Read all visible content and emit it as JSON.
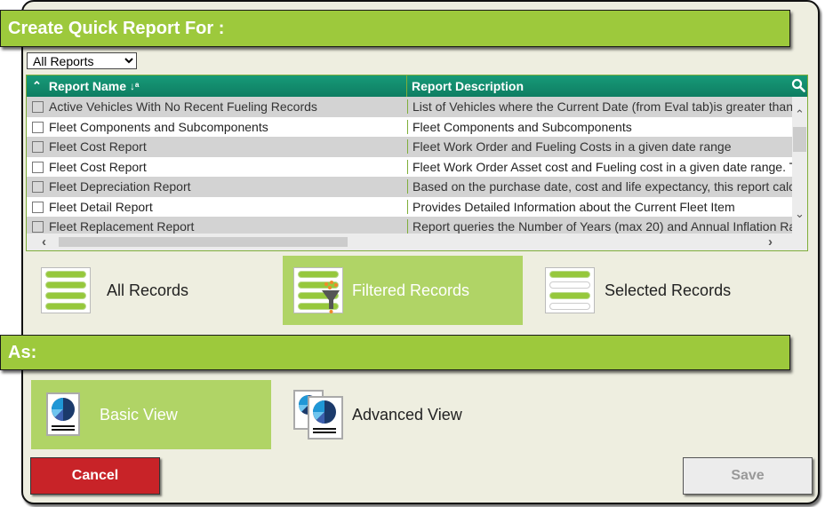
{
  "sections": {
    "create_for_title": "Create Quick Report For :",
    "as_title": "As:"
  },
  "filter": {
    "selected": "All Reports",
    "options": [
      "All Reports"
    ]
  },
  "grid": {
    "columns": {
      "name": "Report Name",
      "description": "Report Description"
    },
    "rows": [
      {
        "name": "Active Vehicles With No Recent Fueling Records",
        "description": "List of Vehicles where the Current Date (from Eval tab)is greater than",
        "checked": false
      },
      {
        "name": "Fleet Components and Subcomponents",
        "description": "Fleet Components and Subcomponents",
        "checked": false
      },
      {
        "name": "Fleet Cost Report",
        "description": "Fleet Work Order and Fueling Costs in a given date range",
        "checked": false
      },
      {
        "name": "Fleet Cost Report",
        "description": "Fleet Work Order Asset cost and Fueling cost in a given date range. T",
        "checked": false
      },
      {
        "name": "Fleet Depreciation Report",
        "description": "Based on the purchase date, cost and life expectancy, this report calc",
        "checked": false
      },
      {
        "name": "Fleet Detail Report",
        "description": "Provides Detailed Information about the Current Fleet Item",
        "checked": false
      },
      {
        "name": "Fleet Replacement Report",
        "description": "Report queries the Number of Years (max 20) and Annual Inflation Ra",
        "checked": false
      }
    ]
  },
  "record_options": [
    {
      "label": "All Records",
      "icon": "all-records-icon",
      "selected": false
    },
    {
      "label": "Filtered Records",
      "icon": "filtered-records-icon",
      "selected": true
    },
    {
      "label": "Selected Records",
      "icon": "selected-records-icon",
      "selected": false
    }
  ],
  "view_options": [
    {
      "label": "Basic View",
      "icon": "basic-view-report-icon",
      "selected": true
    },
    {
      "label": "Advanced View",
      "icon": "advanced-view-report-icon",
      "selected": false
    }
  ],
  "buttons": {
    "cancel": "Cancel",
    "save": "Save"
  },
  "colors": {
    "section_bar": "#9dc93c",
    "selected_option": "#b0d466",
    "grid_header": "#138a6d",
    "cancel": "#c82328",
    "save_disabled": "#ececec"
  }
}
